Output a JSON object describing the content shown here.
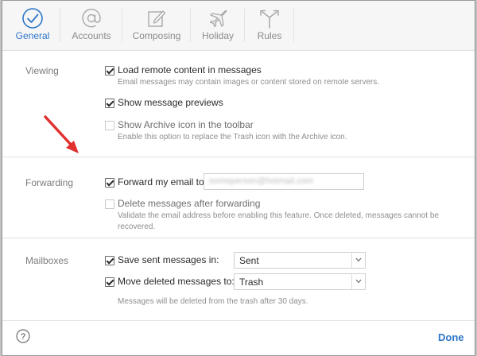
{
  "toolbar": {
    "tabs": [
      {
        "label": "General",
        "icon": "checkmark-circle-icon",
        "active": true
      },
      {
        "label": "Accounts",
        "icon": "at-sign-icon",
        "active": false
      },
      {
        "label": "Composing",
        "icon": "compose-icon",
        "active": false
      },
      {
        "label": "Holiday",
        "icon": "airplane-icon",
        "active": false
      },
      {
        "label": "Rules",
        "icon": "rules-arrows-icon",
        "active": false
      }
    ]
  },
  "viewing": {
    "label": "Viewing",
    "load_remote": {
      "label": "Load remote content in messages",
      "checked": true,
      "help": "Email messages may contain images or content stored on remote servers."
    },
    "show_previews": {
      "label": "Show message previews",
      "checked": true
    },
    "show_archive": {
      "label": "Show Archive icon in the toolbar",
      "checked": false,
      "help": "Enable this option to replace the Trash icon with the Archive icon."
    }
  },
  "forwarding": {
    "label": "Forwarding",
    "forward_email": {
      "label": "Forward my email to:",
      "checked": true,
      "value": "someperson@hotmail.com"
    },
    "delete_after": {
      "label": "Delete messages after forwarding",
      "checked": false,
      "help_line1": "Validate the email address before enabling this feature. Once deleted, messages cannot be",
      "help_line2": "recovered."
    }
  },
  "mailboxes": {
    "label": "Mailboxes",
    "save_sent": {
      "label": "Save sent messages in:",
      "checked": true,
      "selected": "Sent"
    },
    "move_deleted": {
      "label": "Move deleted messages to:",
      "checked": true,
      "selected": "Trash"
    },
    "help": "Messages will be deleted from the trash after 30 days."
  },
  "footer": {
    "help_icon": "question-circle-icon",
    "done_label": "Done"
  },
  "colors": {
    "accent": "#2e76c9",
    "annotation_arrow": "#e0312f"
  }
}
